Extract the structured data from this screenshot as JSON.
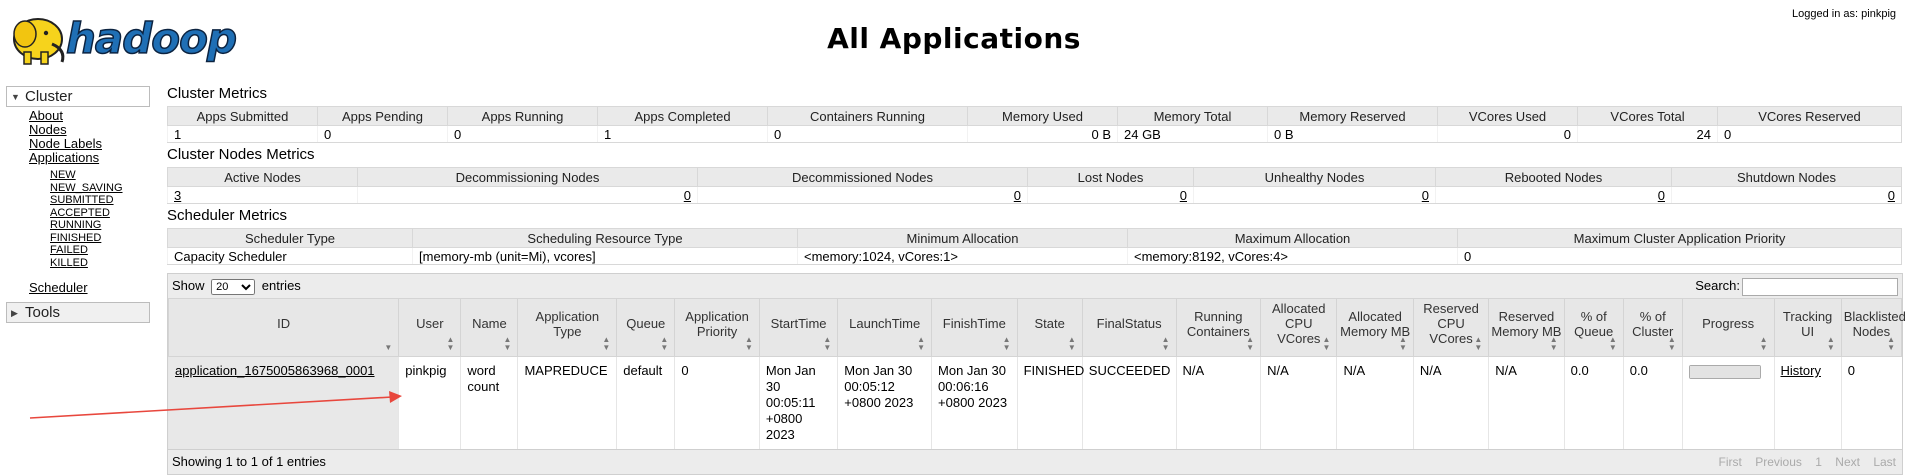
{
  "header": {
    "title": "All Applications",
    "logged_in": "Logged in as: pinkpig",
    "logo_text": "hadoop"
  },
  "nav": {
    "cluster_label": "Cluster",
    "cluster_items": [
      "About",
      "Nodes",
      "Node Labels",
      "Applications"
    ],
    "app_states": [
      "NEW",
      "NEW_SAVING",
      "SUBMITTED",
      "ACCEPTED",
      "RUNNING",
      "FINISHED",
      "FAILED",
      "KILLED"
    ],
    "scheduler": "Scheduler",
    "tools_label": "Tools"
  },
  "cluster_metrics": {
    "title": "Cluster Metrics",
    "headers": [
      "Apps Submitted",
      "Apps Pending",
      "Apps Running",
      "Apps Completed",
      "Containers Running",
      "Memory Used",
      "Memory Total",
      "Memory Reserved",
      "VCores Used",
      "VCores Total",
      "VCores Reserved"
    ],
    "values": [
      "1",
      "0",
      "0",
      "1",
      "0",
      "0 B",
      "24 GB",
      "0 B",
      "0",
      "24",
      "0"
    ]
  },
  "nodes_metrics": {
    "title": "Cluster Nodes Metrics",
    "headers": [
      "Active Nodes",
      "Decommissioning Nodes",
      "Decommissioned Nodes",
      "Lost Nodes",
      "Unhealthy Nodes",
      "Rebooted Nodes",
      "Shutdown Nodes"
    ],
    "values": [
      "3",
      "0",
      "0",
      "0",
      "0",
      "0",
      "0"
    ]
  },
  "scheduler_metrics": {
    "title": "Scheduler Metrics",
    "headers": [
      "Scheduler Type",
      "Scheduling Resource Type",
      "Minimum Allocation",
      "Maximum Allocation",
      "Maximum Cluster Application Priority"
    ],
    "values": [
      "Capacity Scheduler",
      "[memory-mb (unit=Mi), vcores]",
      "<memory:1024, vCores:1>",
      "<memory:8192, vCores:4>",
      "0"
    ]
  },
  "apps_table": {
    "show_label": "Show",
    "entries_label": "entries",
    "page_size": "20",
    "search_label": "Search:",
    "search_value": "",
    "headers": [
      "ID",
      "User",
      "Name",
      "Application Type",
      "Queue",
      "Application Priority",
      "StartTime",
      "LaunchTime",
      "FinishTime",
      "State",
      "FinalStatus",
      "Running Containers",
      "Allocated CPU VCores",
      "Allocated Memory MB",
      "Reserved CPU VCores",
      "Reserved Memory MB",
      "% of Queue",
      "% of Cluster",
      "Progress",
      "Tracking UI",
      "Blacklisted Nodes"
    ],
    "rows": [
      {
        "id": "application_1675005863968_0001",
        "user": "pinkpig",
        "name": "word count",
        "type": "MAPREDUCE",
        "queue": "default",
        "priority": "0",
        "start": "Mon Jan 30 00:05:11 +0800 2023",
        "launch": "Mon Jan 30 00:05:12 +0800 2023",
        "finish": "Mon Jan 30 00:06:16 +0800 2023",
        "state": "FINISHED",
        "final_status": "SUCCEEDED",
        "running_containers": "N/A",
        "alloc_vcores": "N/A",
        "alloc_mem": "N/A",
        "res_vcores": "N/A",
        "res_mem": "N/A",
        "pct_queue": "0.0",
        "pct_cluster": "0.0",
        "progress": 1.0,
        "tracking": "History",
        "blacklisted": "0"
      }
    ],
    "info": "Showing 1 to 1 of 1 entries",
    "pager": [
      "First",
      "Previous",
      "1",
      "Next",
      "Last"
    ]
  },
  "colors": {
    "header_bg": "#eaeaea",
    "annotation_arrow": "#e8473d",
    "logo_yellow": "#f6d31c",
    "logo_blue": "#1f6fb5"
  }
}
